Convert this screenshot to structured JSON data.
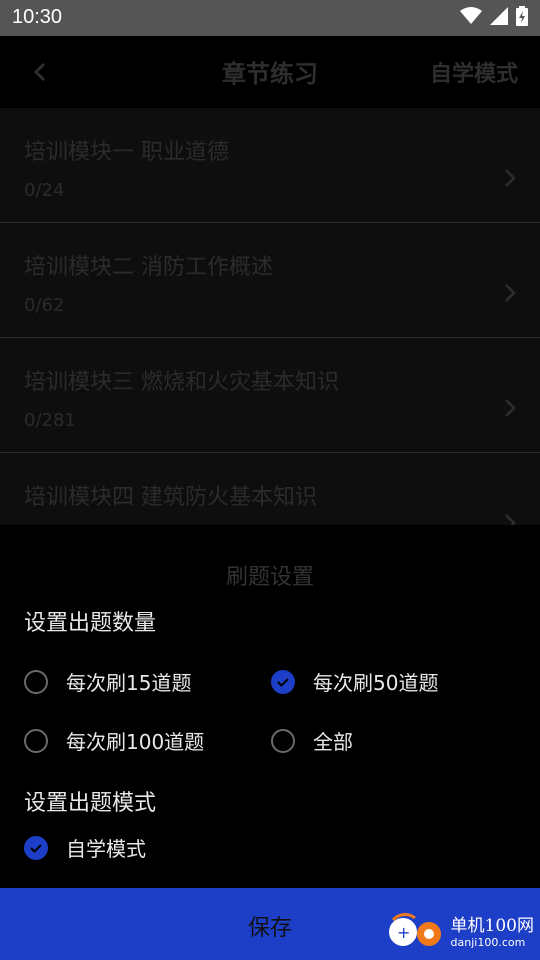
{
  "status_bar": {
    "time": "10:30"
  },
  "app_bar": {
    "title": "章节练习",
    "mode_button": "自学模式"
  },
  "chapters": [
    {
      "title": "培训模块一 职业道德",
      "count": "0/24"
    },
    {
      "title": "培训模块二 消防工作概述",
      "count": "0/62"
    },
    {
      "title": "培训模块三 燃烧和火灾基本知识",
      "count": "0/281"
    },
    {
      "title": "培训模块四 建筑防火基本知识",
      "count": ""
    }
  ],
  "sheet": {
    "title": "刷题设置",
    "count_section_label": "设置出题数量",
    "count_options": [
      {
        "label": "每次刷15道题",
        "checked": false
      },
      {
        "label": "每次刷50道题",
        "checked": true
      },
      {
        "label": "每次刷100道题",
        "checked": false
      },
      {
        "label": "全部",
        "checked": false
      }
    ],
    "mode_section_label": "设置出题模式",
    "mode_options": [
      {
        "label": "自学模式",
        "checked": true
      }
    ],
    "save_label": "保存"
  },
  "watermark": {
    "name": "单机100网",
    "domain": "danji100.com"
  },
  "colors": {
    "accent": "#1d3ec6",
    "background": "#000000"
  }
}
